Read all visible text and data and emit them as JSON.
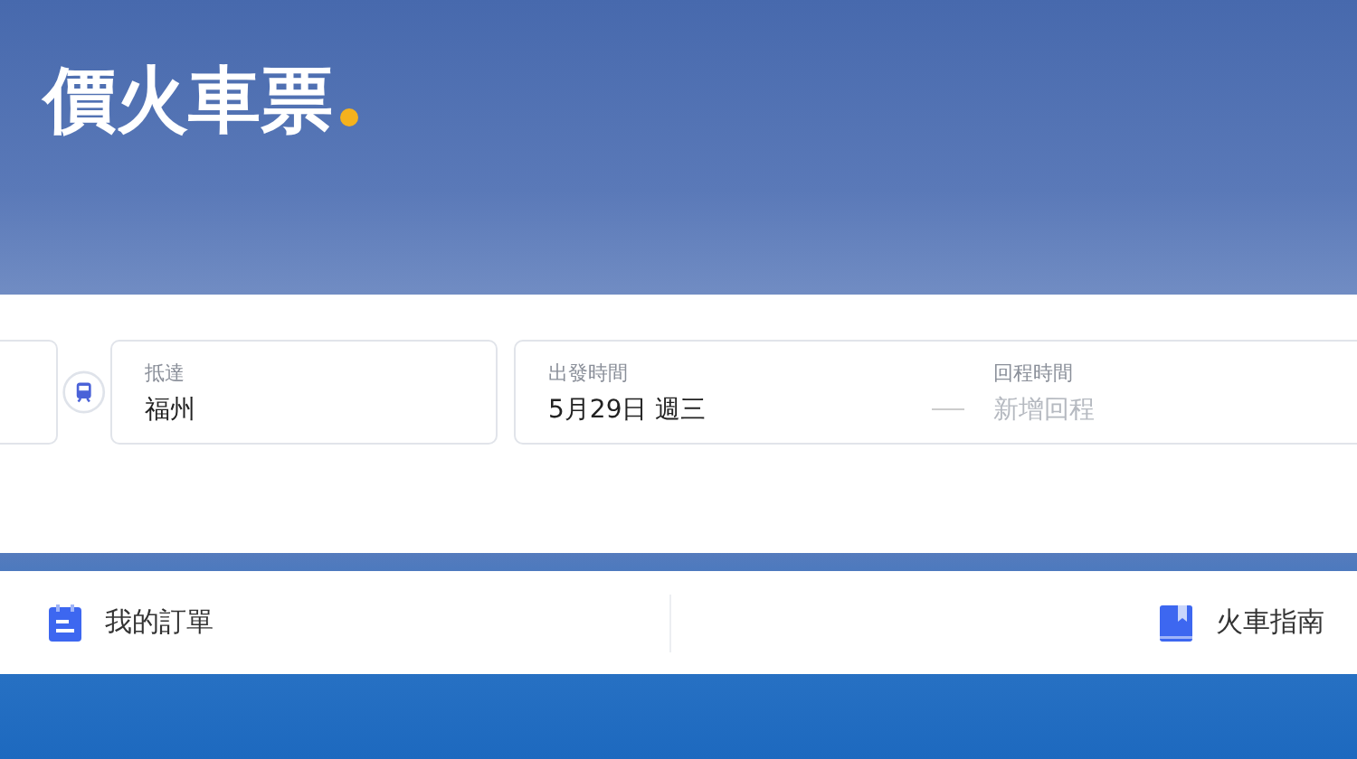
{
  "hero": {
    "title": "價火車票"
  },
  "search": {
    "arrive": {
      "label": "抵達",
      "value": "福州"
    },
    "depart_date": {
      "label": "出發時間",
      "value": "5月29日 週三"
    },
    "return_date": {
      "label": "回程時間",
      "placeholder": "新增回程"
    }
  },
  "links": [
    {
      "kind": "orders",
      "label": "我的訂單"
    },
    {
      "kind": "guide",
      "label": "火車指南"
    }
  ]
}
